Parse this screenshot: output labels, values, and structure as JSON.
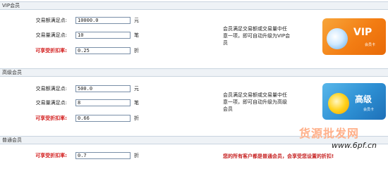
{
  "sections": [
    {
      "title": "VIP会员",
      "rows": [
        {
          "label": "交易额满足点:",
          "value": "10000.0",
          "unit": "元",
          "red": false
        },
        {
          "label": "交易量满足点:",
          "value": "10",
          "unit": "笔",
          "red": false
        },
        {
          "label": "可享受折扣率:",
          "value": "0.25",
          "unit": "折",
          "red": true
        }
      ],
      "description": [
        "会员满足交易额或交易量中任",
        "意一项，即可自动升级为VIP会",
        "员"
      ],
      "card": {
        "big": "VIP",
        "small": "会员卡"
      }
    },
    {
      "title": "高级会员",
      "rows": [
        {
          "label": "交易额满足点:",
          "value": "500.0",
          "unit": "元",
          "red": false
        },
        {
          "label": "交易量满足点:",
          "value": "8",
          "unit": "笔",
          "red": false
        },
        {
          "label": "可享受折扣率:",
          "value": "0.66",
          "unit": "折",
          "red": true
        }
      ],
      "description": [
        "会员满足交易额或交易量中任",
        "意一项，即可自动升级为高级",
        "会员"
      ],
      "card": {
        "big": "高级",
        "small": "会员卡"
      }
    },
    {
      "title": "普通会员",
      "rows": [
        {
          "label": "可享受折扣率:",
          "value": "0.7",
          "unit": "折",
          "red": true
        }
      ],
      "description_red": "您的所有客户都是普通会员，会享受您设置的折扣!"
    }
  ],
  "watermark": {
    "line1": "货源批发网",
    "line2": "www.6pf.cn"
  },
  "colors": {
    "header_bg": "#eef2f6",
    "red_label": "#d21a1a",
    "vip_card": "#f37d13",
    "gold_card": "#2d8fd3"
  }
}
